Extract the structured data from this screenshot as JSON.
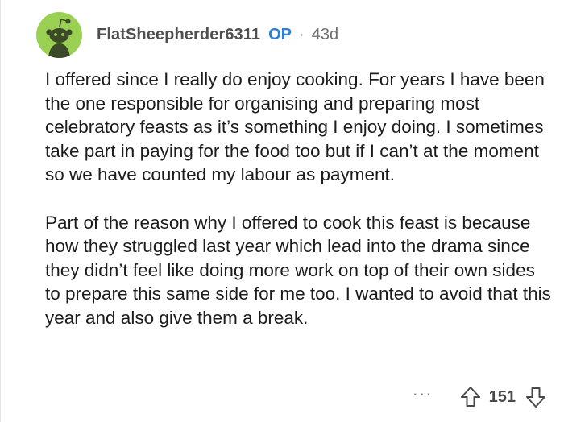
{
  "comment": {
    "author": "FlatSheepherder6311",
    "op_badge": "OP",
    "separator": "·",
    "age": "43d",
    "avatar_icon": "snoo-avatar-icon",
    "avatar_color": "#9bd153",
    "paragraphs": [
      "I offered since I really do enjoy cooking. For years I have been the one responsible for organising and preparing most celebratory feasts as it’s something I enjoy doing. I sometimes take part in paying for the food too but if I can’t at the moment so we have counted my labour as payment.",
      "Part of the reason why I offered to cook this feast is because how they struggled last year which lead into the drama since they didn’t feel like doing more work on top of their own sides to prepare this same side for me too. I wanted to avoid that this year and also give them a break."
    ]
  },
  "actions": {
    "more_label": "···",
    "vote_count": "151",
    "upvote_icon": "upvote-arrow-icon",
    "downvote_icon": "downvote-arrow-icon"
  },
  "colors": {
    "op_accent": "#2f7fd6",
    "username": "#4f4f4f"
  }
}
